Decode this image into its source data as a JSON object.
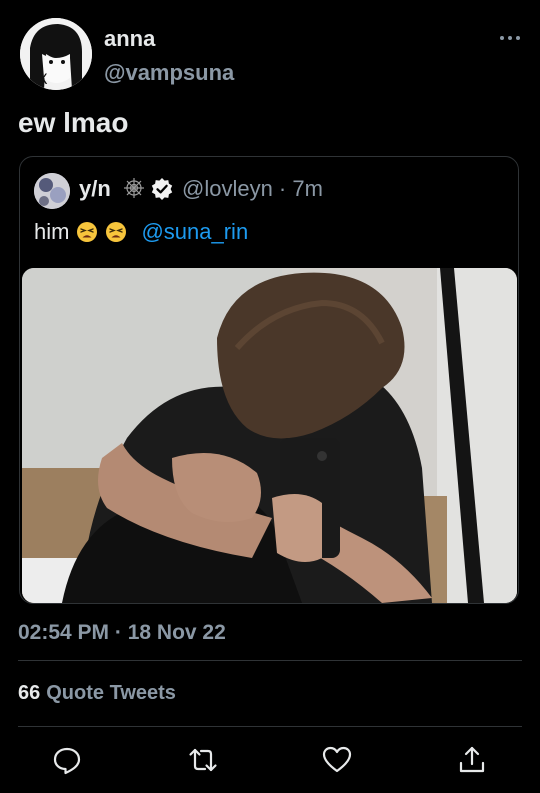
{
  "author": {
    "display_name": "anna",
    "handle": "@vampsuna"
  },
  "tweet": {
    "text": "ew lmao",
    "timestamp": "02:54 PM · 18 Nov 22"
  },
  "quoted": {
    "name": "y/n",
    "meta": "@lovleyn · 7m",
    "body_text": "him",
    "mention": "@suna_rin"
  },
  "stats": {
    "quote_count": "66",
    "quote_label": "Quote Tweets"
  },
  "icons": {
    "more": "more-horizontal-icon",
    "reply": "reply-icon",
    "retweet": "retweet-icon",
    "like": "heart-icon",
    "share": "share-icon",
    "verified": "verified-badge-icon",
    "spider_web": "spider-web-icon"
  },
  "colors": {
    "background": "#000000",
    "text_primary": "#e7e9ea",
    "text_secondary": "#8b98a5",
    "link": "#1d9bf0",
    "border": "#2f3336"
  }
}
